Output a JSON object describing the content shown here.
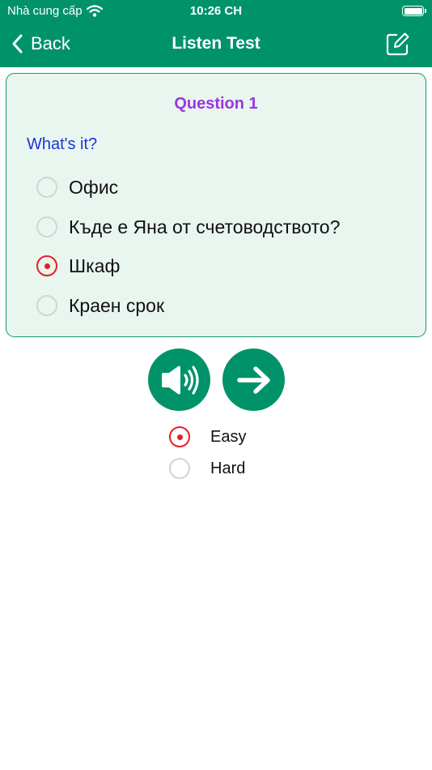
{
  "status_bar": {
    "carrier": "Nhà cung cấp",
    "time": "10:26 CH"
  },
  "nav": {
    "back_label": "Back",
    "title": "Listen Test"
  },
  "question": {
    "title": "Question 1",
    "prompt": "What's it?",
    "options": [
      {
        "label": "Офис",
        "selected": false
      },
      {
        "label": "Къде е Яна от счетоводството?",
        "selected": false
      },
      {
        "label": "Шкаф",
        "selected": true
      },
      {
        "label": "Краен срок",
        "selected": false
      }
    ]
  },
  "difficulty": {
    "options": [
      {
        "label": "Easy",
        "selected": true
      },
      {
        "label": "Hard",
        "selected": false
      }
    ]
  },
  "colors": {
    "brand": "#00936a",
    "selected": "#ea1c24",
    "question_title": "#9b35e6",
    "prompt": "#1a35d6",
    "card_bg": "#e9f6ef"
  },
  "icons": {
    "back": "chevron-left-icon",
    "edit": "edit-icon",
    "speaker": "speaker-icon",
    "next": "arrow-right-icon",
    "wifi": "wifi-icon",
    "battery": "battery-icon"
  }
}
